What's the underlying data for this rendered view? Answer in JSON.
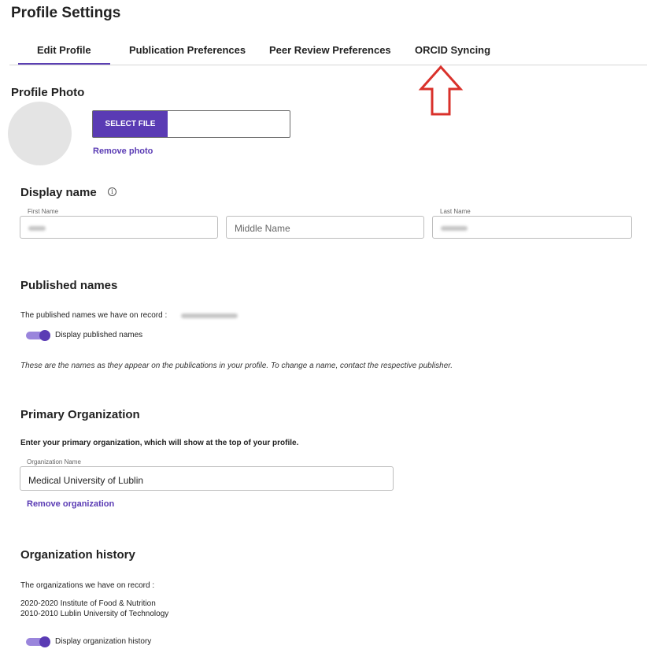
{
  "page_title": "Profile Settings",
  "tabs": [
    {
      "label": "Edit Profile",
      "active": true
    },
    {
      "label": "Publication Preferences",
      "active": false
    },
    {
      "label": "Peer Review Preferences",
      "active": false
    },
    {
      "label": "ORCID Syncing",
      "active": false
    }
  ],
  "annotation": {
    "icon": "up-arrow-icon",
    "color": "#d9312b"
  },
  "profile_photo": {
    "heading": "Profile Photo",
    "select_file_label": "SELECT FILE",
    "remove_label": "Remove photo"
  },
  "display_name": {
    "heading": "Display name",
    "info_icon": "info-icon",
    "first_name_label": "First Name",
    "middle_name_placeholder": "Middle Name",
    "last_name_label": "Last Name"
  },
  "published_names": {
    "heading": "Published names",
    "record_text": "The published names we have on record :",
    "toggle_label": "Display published names",
    "toggle_on": true,
    "note": "These are the names as they appear on the publications in your profile. To change a name, contact the respective publisher."
  },
  "primary_organization": {
    "heading": "Primary Organization",
    "instruction": "Enter your primary organization, which will show at the top of your profile.",
    "field_label": "Organization Name",
    "field_value": "Medical University of Lublin",
    "remove_label": "Remove organization"
  },
  "organization_history": {
    "heading": "Organization history",
    "record_text": "The organizations we have on record :",
    "entries": [
      "2020-2020 Institute of Food & Nutrition",
      "2010-2010 Lublin University of Technology"
    ],
    "toggle_label": "Display organization history",
    "toggle_on": true
  },
  "colors": {
    "accent": "#5a3bb4",
    "toggle_track": "#9a85dc"
  }
}
